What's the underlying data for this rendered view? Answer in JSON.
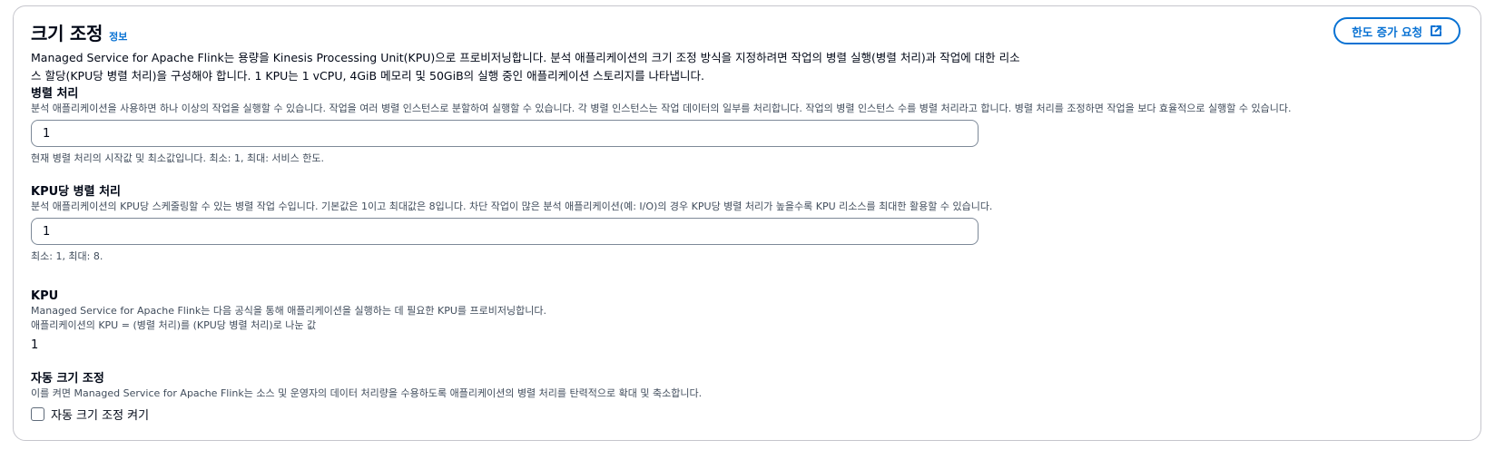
{
  "header": {
    "title": "크기 조정",
    "info_link": "정보",
    "description": "Managed Service for Apache Flink는 용량을 Kinesis Processing Unit(KPU)으로 프로비저닝합니다. 분석 애플리케이션의 크기 조정 방식을 지정하려면 작업의 병렬 실행(병렬 처리)과 작업에 대한 리소스 할당(KPU당 병렬 처리)을 구성해야 합니다. 1 KPU는 1 vCPU, 4GiB 메모리 및 50GiB의 실행 중인 애플리케이션 스토리지를 나타냅니다.",
    "limit_button": "한도 증가 요청",
    "limit_button_icon": "external-link-icon"
  },
  "parallelism": {
    "label": "병렬 처리",
    "description": "분석 애플리케이션을 사용하면 하나 이상의 작업을 실행할 수 있습니다. 작업을 여러 병렬 인스턴스로 분할하여 실행할 수 있습니다. 각 병렬 인스턴스는 작업 데이터의 일부를 처리합니다. 작업의 병렬 인스턴스 수를 병렬 처리라고 합니다. 병렬 처리를 조정하면 작업을 보다 효율적으로 실행할 수 있습니다.",
    "value": "1",
    "hint": "현재 병렬 처리의 시작값 및 최소값입니다. 최소: 1, 최대: 서비스 한도."
  },
  "parallelism_per_kpu": {
    "label": "KPU당 병렬 처리",
    "description": "분석 애플리케이션의 KPU당 스케줄링할 수 있는 병렬 작업 수입니다. 기본값은 1이고 최대값은 8입니다. 차단 작업이 많은 분석 애플리케이션(예: I/O)의 경우 KPU당 병렬 처리가 높을수록 KPU 리소스를 최대한 활용할 수 있습니다.",
    "value": "1",
    "hint": "최소: 1, 최대: 8."
  },
  "kpu": {
    "label": "KPU",
    "description": "Managed Service for Apache Flink는 다음 공식을 통해 애플리케이션을 실행하는 데 필요한 KPU를 프로비저닝합니다.",
    "formula": "애플리케이션의 KPU = (병렬 처리)를 (KPU당 병렬 처리)로 나눈 값",
    "value": "1"
  },
  "autoscaling": {
    "label": "자동 크기 조정",
    "description": "이를 켜면 Managed Service for Apache Flink는 소스 및 운영자의 데이터 처리량을 수용하도록 애플리케이션의 병렬 처리를 탄력적으로 확대 및 축소합니다.",
    "checkbox_label": "자동 크기 조정 켜기",
    "checked": false
  },
  "colors": {
    "accent": "#0972d3",
    "border": "#c6c6cd",
    "text": "#000716",
    "secondary_text": "#414d5c"
  }
}
